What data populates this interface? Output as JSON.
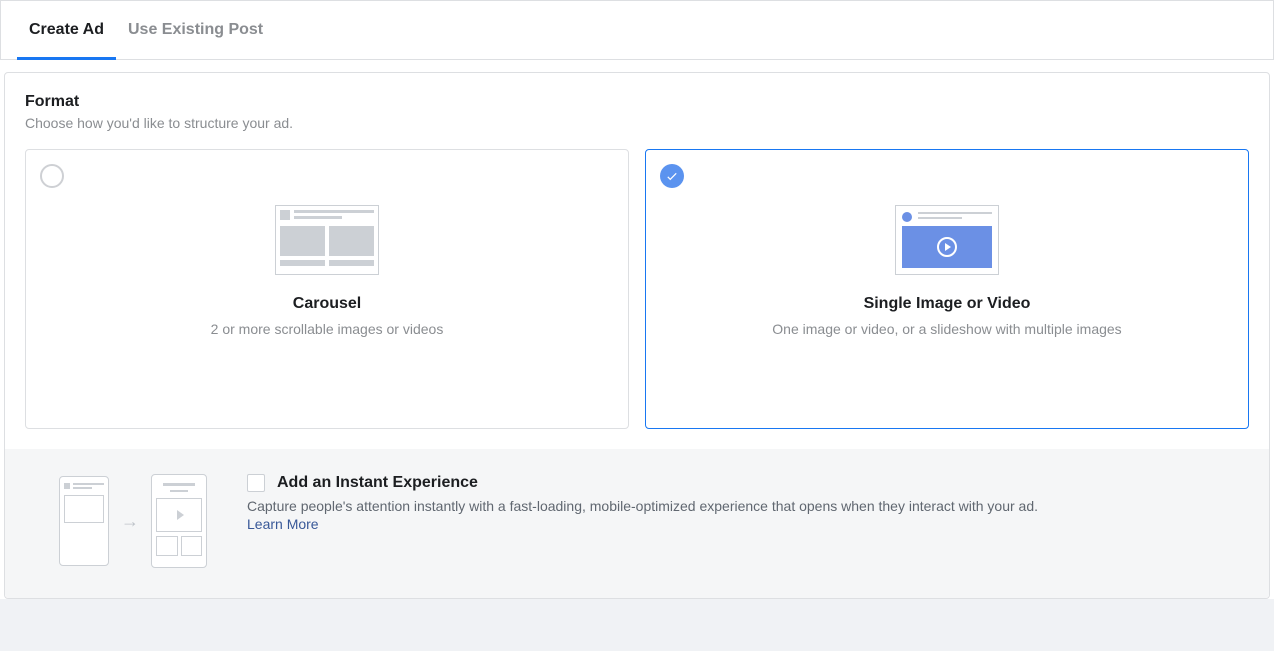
{
  "tabs": {
    "create_ad": "Create Ad",
    "use_existing": "Use Existing Post"
  },
  "format": {
    "title": "Format",
    "subtitle": "Choose how you'd like to structure your ad."
  },
  "options": {
    "carousel": {
      "title": "Carousel",
      "desc": "2 or more scrollable images or videos"
    },
    "single": {
      "title": "Single Image or Video",
      "desc": "One image or video, or a slideshow with multiple images"
    }
  },
  "instant": {
    "title": "Add an Instant Experience",
    "desc": "Capture people's attention instantly with a fast-loading, mobile-optimized experience that opens when they interact with your ad.",
    "link": "Learn More"
  }
}
